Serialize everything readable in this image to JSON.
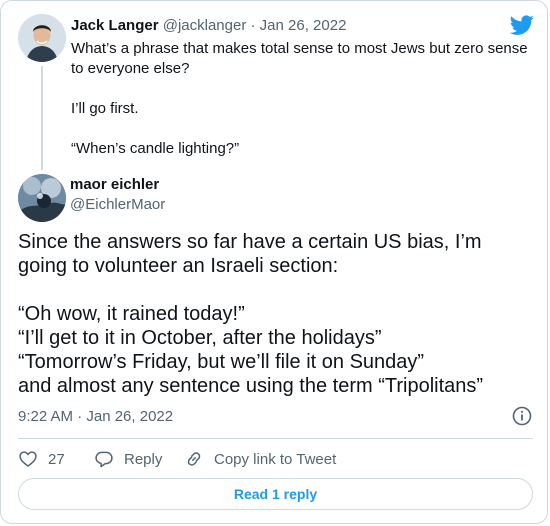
{
  "parent": {
    "name": "Jack Langer",
    "handle": "@jacklanger",
    "separator": "·",
    "date": "Jan 26, 2022",
    "lines": [
      "What’s a phrase that makes total sense to most Jews but zero sense",
      "to everyone else?",
      "",
      "I’ll go first.",
      "",
      "“When’s candle lighting?”"
    ]
  },
  "author": {
    "name": "maor eichler",
    "handle": "@EichlerMaor"
  },
  "tweet": {
    "lines": [
      "Since the answers so far have a certain US bias, I’m",
      "going to volunteer an Israeli section:",
      "",
      "“Oh wow, it rained today!”",
      "“I’ll get to it in October, after the holidays”",
      "“Tomorrow’s Friday, but we’ll file it on Sunday”",
      "and almost any sentence using the term “Tripolitans”"
    ],
    "timestamp": "9:22 AM · Jan 26, 2022"
  },
  "actions": {
    "like_count": "27",
    "reply_label": "Reply",
    "copy_label": "Copy link to Tweet"
  },
  "read_reply_label": "Read 1 reply",
  "icons": {
    "brand": "twitter-bird-icon",
    "info": "info-icon",
    "like": "heart-icon",
    "reply": "reply-bubble-icon",
    "copy": "link-icon"
  },
  "colors": {
    "accent": "#1d9bf0",
    "text": "#0f1419",
    "muted": "#536471",
    "border": "#cfd9de"
  }
}
